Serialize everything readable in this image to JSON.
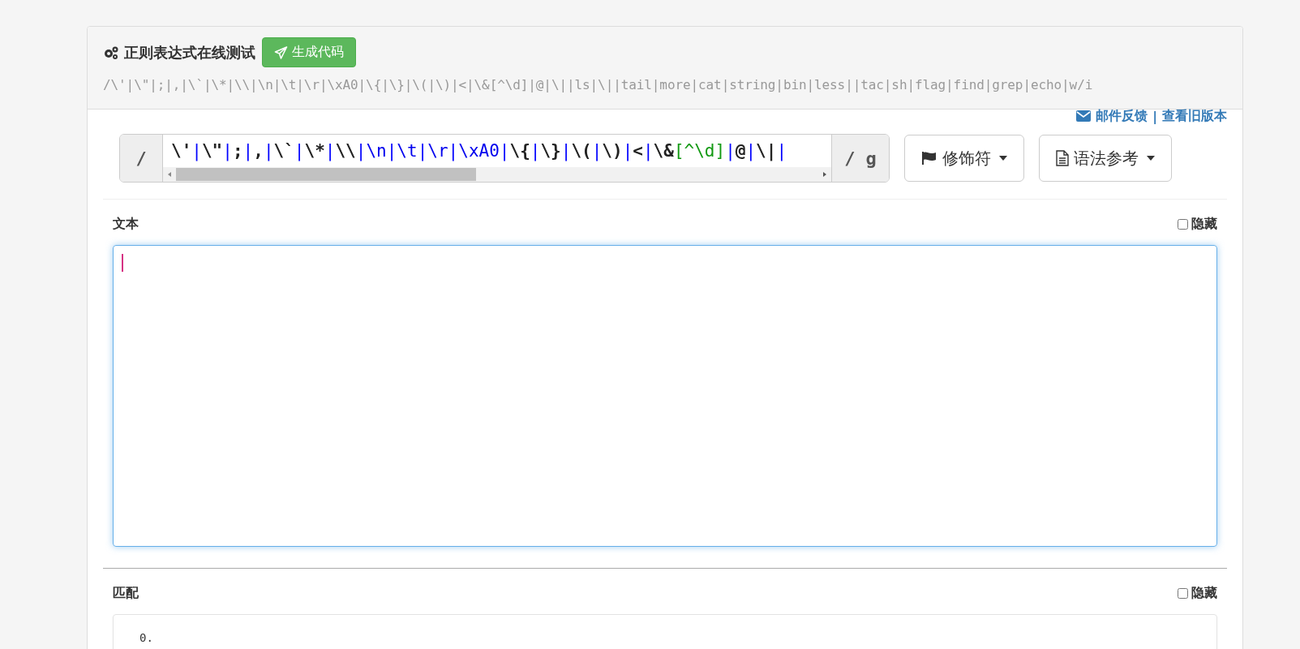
{
  "header": {
    "title": "正则表达式在线测试",
    "generate_button": "生成代码",
    "regex_summary": "/\\'|\\\"|;|,|\\`|\\*|\\\\|\\n|\\t|\\r|\\xA0|\\{|\\}|\\(|\\)|<|\\&[^\\d]|@|\\||ls|\\||tail|more|cat|string|bin|less||tac|sh|flag|find|grep|echo|w/i"
  },
  "links": [
    "邮件反馈",
    "|",
    "查看旧版本"
  ],
  "regex": {
    "open": "/",
    "close": "/ g",
    "tokens": [
      {
        "text": "\\'",
        "kind": "literal"
      },
      {
        "text": "|",
        "kind": "alt"
      },
      {
        "text": "\\\"",
        "kind": "literal"
      },
      {
        "text": "|",
        "kind": "alt"
      },
      {
        "text": ";",
        "kind": "literal"
      },
      {
        "text": "|",
        "kind": "alt"
      },
      {
        "text": ",",
        "kind": "literal"
      },
      {
        "text": "|",
        "kind": "alt"
      },
      {
        "text": "\\`",
        "kind": "literal"
      },
      {
        "text": "|",
        "kind": "alt"
      },
      {
        "text": "\\*",
        "kind": "literal"
      },
      {
        "text": "|",
        "kind": "alt"
      },
      {
        "text": "\\\\",
        "kind": "literal"
      },
      {
        "text": "|",
        "kind": "alt"
      },
      {
        "text": "\\n",
        "kind": "escape"
      },
      {
        "text": "|",
        "kind": "alt"
      },
      {
        "text": "\\t",
        "kind": "escape"
      },
      {
        "text": "|",
        "kind": "alt"
      },
      {
        "text": "\\r",
        "kind": "escape"
      },
      {
        "text": "|",
        "kind": "alt"
      },
      {
        "text": "\\xA0",
        "kind": "escape"
      },
      {
        "text": "|",
        "kind": "alt"
      },
      {
        "text": "\\{",
        "kind": "literal"
      },
      {
        "text": "|",
        "kind": "alt"
      },
      {
        "text": "\\}",
        "kind": "literal"
      },
      {
        "text": "|",
        "kind": "alt"
      },
      {
        "text": "\\(",
        "kind": "literal"
      },
      {
        "text": "|",
        "kind": "alt"
      },
      {
        "text": "\\)",
        "kind": "literal"
      },
      {
        "text": "|",
        "kind": "alt"
      },
      {
        "text": "<",
        "kind": "literal"
      },
      {
        "text": "|",
        "kind": "alt"
      },
      {
        "text": "\\&",
        "kind": "literal"
      },
      {
        "text": "[^\\d]",
        "kind": "class"
      },
      {
        "text": "|",
        "kind": "alt"
      },
      {
        "text": "@",
        "kind": "literal"
      },
      {
        "text": "|",
        "kind": "alt"
      },
      {
        "text": "\\|",
        "kind": "literal"
      },
      {
        "text": "|",
        "kind": "alt"
      }
    ],
    "modifier_button": "修饰符",
    "syntax_button": "语法参考"
  },
  "text_section": {
    "label": "文本",
    "hide_label": "隐藏",
    "hidden": false
  },
  "match_section": {
    "label": "匹配",
    "hide_label": "隐藏",
    "hidden": false,
    "results": [
      "0."
    ]
  }
}
